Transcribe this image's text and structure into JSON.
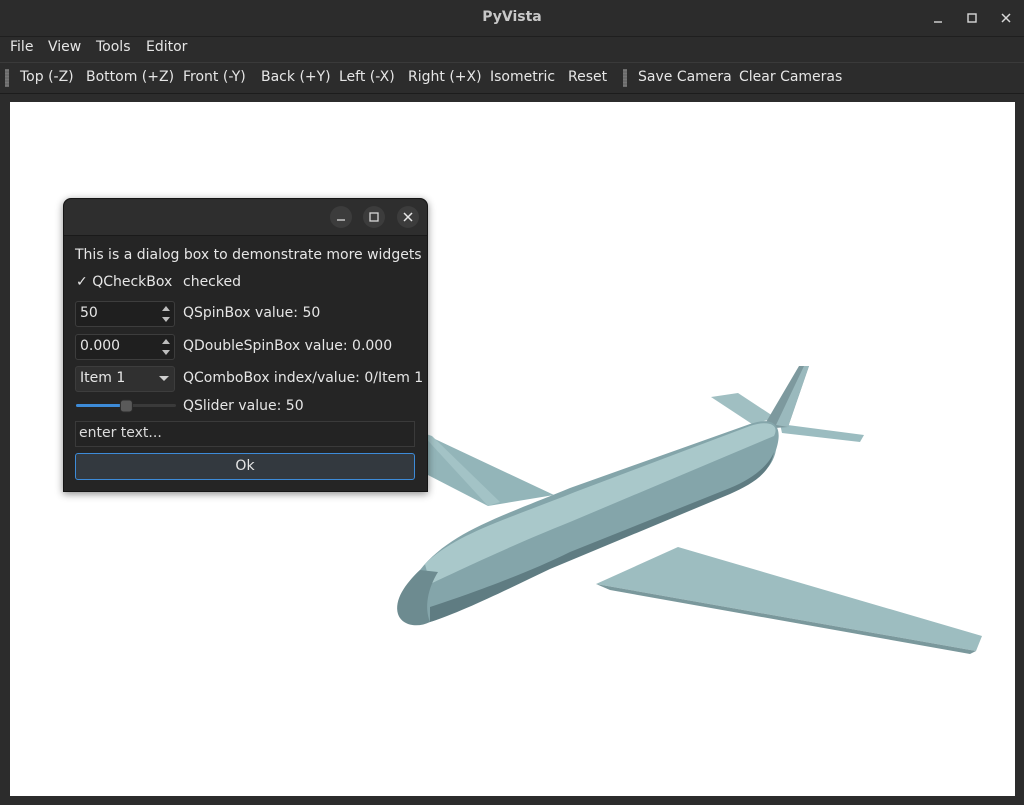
{
  "window": {
    "title": "PyVista"
  },
  "menu": {
    "items": [
      "File",
      "View",
      "Tools",
      "Editor"
    ]
  },
  "toolbar": {
    "views": [
      "Top (-Z)",
      "Bottom (+Z)",
      "Front (-Y)",
      "Back (+Y)",
      "Left (-X)",
      "Right (+X)",
      "Isometric",
      "Reset"
    ],
    "camera": [
      "Save Camera",
      "Clear Cameras"
    ]
  },
  "dialog": {
    "description": "This is a dialog box to demonstrate more widgets",
    "checkbox": {
      "label": "QCheckBox",
      "checked": true,
      "status": "checked"
    },
    "spinbox": {
      "value": "50",
      "status": "QSpinBox value: 50"
    },
    "double_spinbox": {
      "value": "0.000",
      "status": "QDoubleSpinBox value: 0.000"
    },
    "combobox": {
      "selected": "Item 1",
      "status": "QComboBox index/value: 0/Item 1"
    },
    "slider": {
      "value": 50,
      "min": 0,
      "max": 99,
      "status": "QSlider value: 50"
    },
    "text_input": {
      "value": "enter text..."
    },
    "ok_button": "Ok"
  },
  "colors": {
    "mesh": "#8fb0b5",
    "accent": "#3d8bd8",
    "viewport_bg": "#ffffff"
  }
}
